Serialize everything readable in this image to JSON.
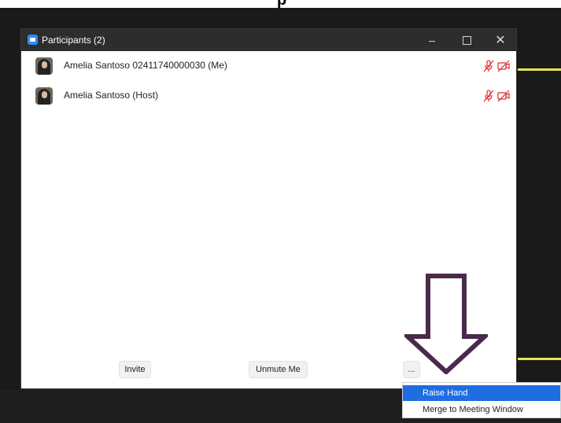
{
  "window": {
    "title": "Participants (2)",
    "min_glyph": "–",
    "close_glyph": "✕"
  },
  "participants": [
    {
      "name": "Amelia Santoso 02411740000030 (Me)",
      "mic": "muted",
      "video": "off"
    },
    {
      "name": "Amelia Santoso (Host)",
      "mic": "muted",
      "video": "off"
    }
  ],
  "buttons": {
    "invite": "Invite",
    "unmute": "Unmute Me",
    "more": "..."
  },
  "context_menu": {
    "items": [
      "Raise Hand",
      "Merge to Meeting Window"
    ],
    "highlighted": "Raise Hand"
  },
  "colors": {
    "accent": "#2d8cff",
    "muted_icon": "#e02828",
    "annotation_arrow": "#4a2a4a",
    "highlight": "#1f6de0"
  },
  "icons": {
    "app": "zoom-app-icon",
    "mic": "mic-muted-icon",
    "video": "video-off-icon",
    "annotation": "down-arrow-annotation"
  }
}
